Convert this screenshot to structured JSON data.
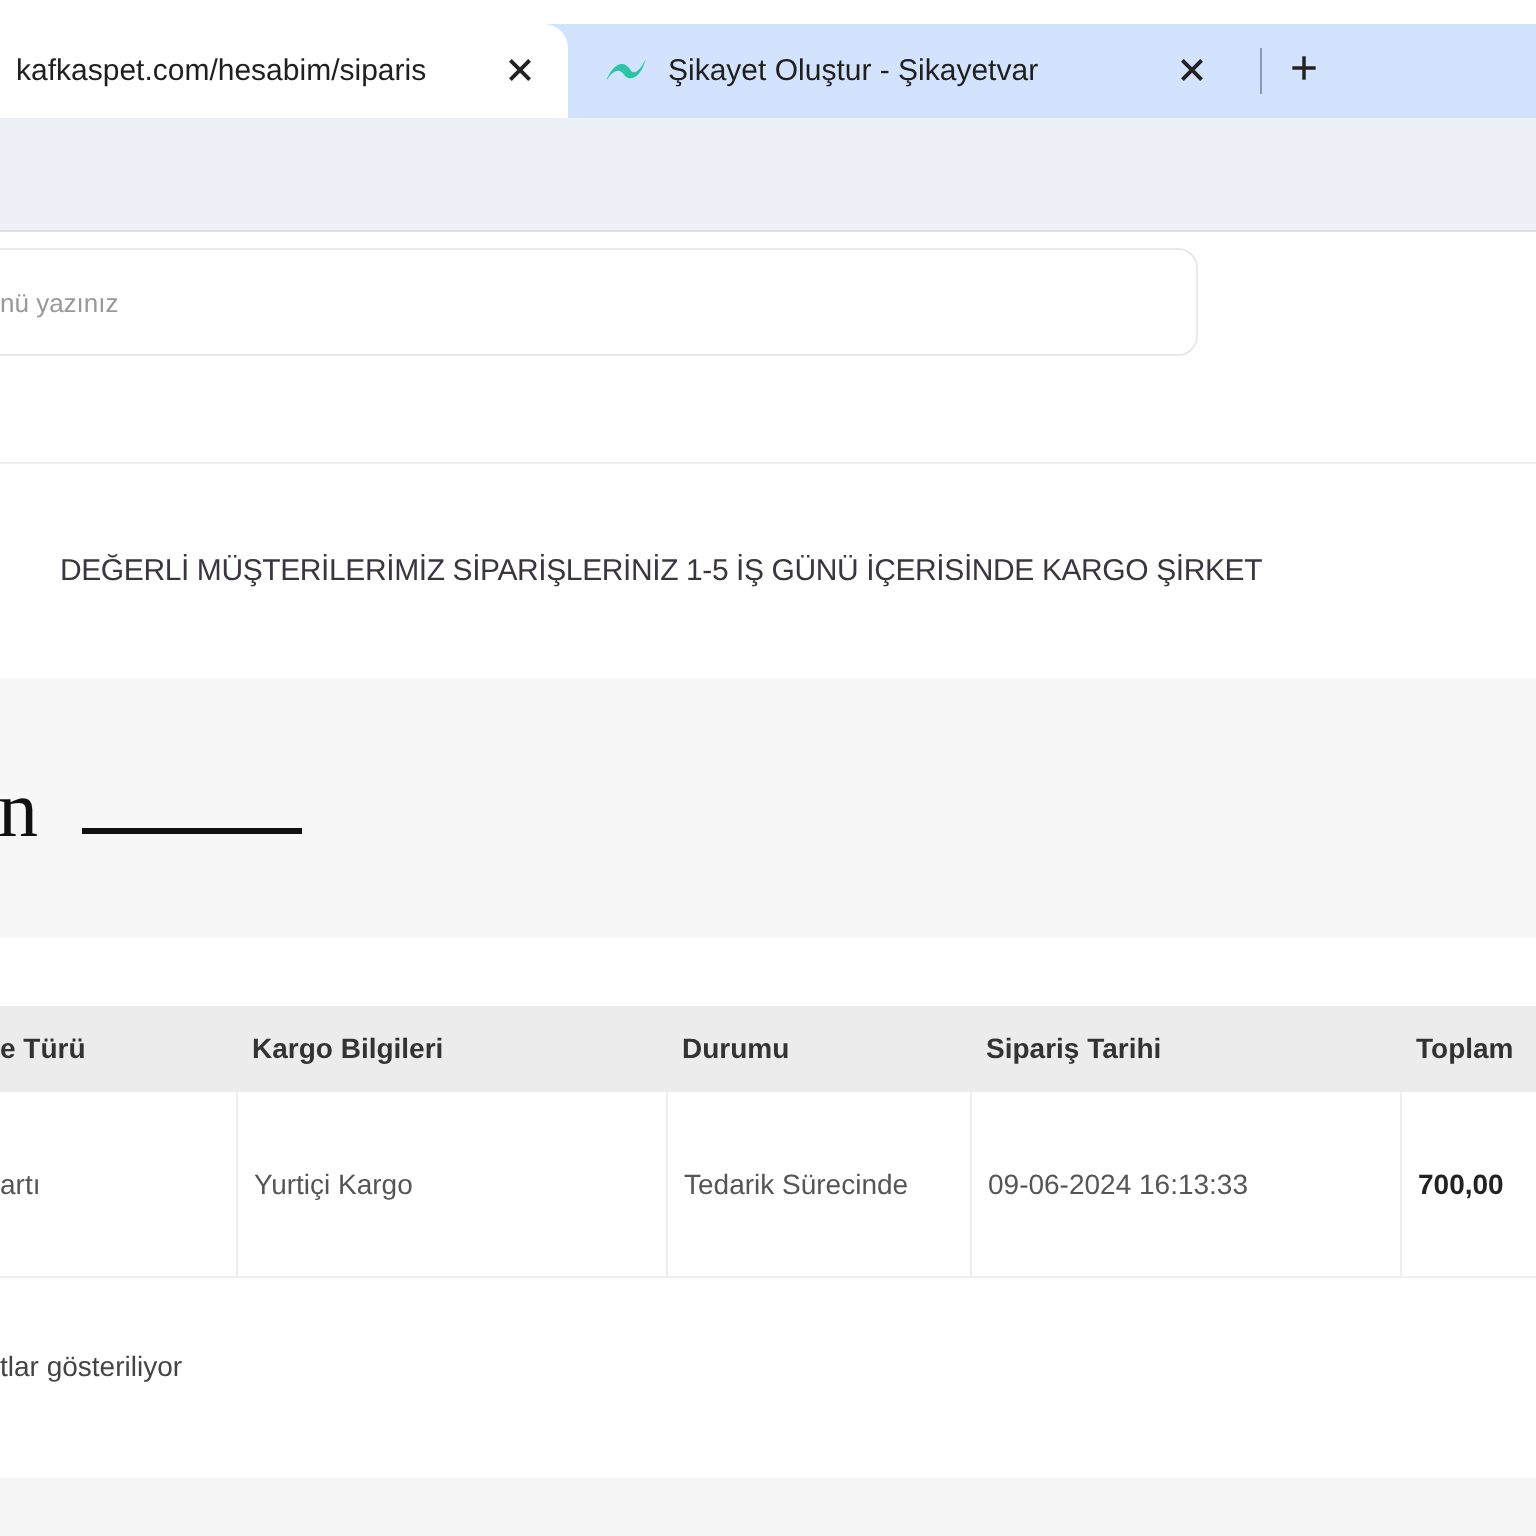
{
  "browser": {
    "tabs": [
      {
        "title": "kafkaspet.com/hesabim/siparis",
        "selected": true,
        "kind": "plain"
      },
      {
        "title": "Şikayet Oluştur - Şikayetvar",
        "selected": false,
        "kind": "favicon"
      }
    ],
    "new_tab": "+"
  },
  "search": {
    "placeholder": "nü yazınız"
  },
  "notice": "DEĞERLİ MÜŞTERİLERİMİZ SİPARİŞLERİNİZ 1-5 İŞ GÜNÜ İÇERİSİNDE KARGO ŞİRKET",
  "page_heading": "n",
  "table": {
    "columns": [
      "e Türü",
      "Kargo Bilgileri",
      "Durumu",
      "Sipariş Tarihi",
      "Toplam"
    ],
    "rows": [
      [
        "artı",
        "Yurtiçi Kargo",
        "Tedarik Sürecinde",
        "09-06-2024 16:13:33",
        "700,00"
      ]
    ]
  },
  "footer": "tlar gösteriliyor"
}
